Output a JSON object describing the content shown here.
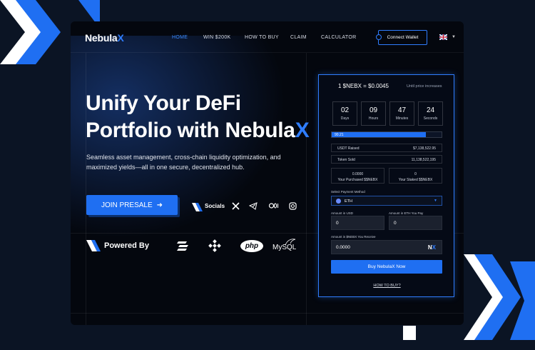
{
  "nav": {
    "logo_text": "Nebula",
    "logo_accent": "X",
    "items": [
      "HOME",
      "WIN $200K",
      "HOW TO BUY",
      "CLAIM",
      "CALCULATOR"
    ],
    "wallet_label": "Connect Wallet",
    "language_icon": "uk-flag-icon"
  },
  "hero": {
    "title_line1": "Unify Your DeFi",
    "title_line2_prefix": "Portfolio with Nebula",
    "title_line2_accent": "X",
    "subtitle": "Seamless asset management, cross-chain liquidity optimization, and maximized yields—all in one secure, decentralized hub.",
    "join_label": "JOIN PRESALE",
    "join_arrow": "➜",
    "socials_label": "Socials",
    "social_icons": [
      "x-icon",
      "telegram-icon",
      "medium-icon",
      "instagram-icon"
    ],
    "powered_label": "Powered By",
    "tech_icons": [
      "solana-icon",
      "binance-icon",
      "php-logo",
      "mysql-logo"
    ],
    "php_text": "php",
    "mysql_text": "MySQL"
  },
  "presale": {
    "price": "1 $NEBX = $0.0045",
    "price_note": "Until price increases",
    "countdown": [
      {
        "num": "02",
        "label": "Days"
      },
      {
        "num": "09",
        "label": "Hours"
      },
      {
        "num": "47",
        "label": "Minutes"
      },
      {
        "num": "24",
        "label": "Seconds"
      }
    ],
    "progress_label": "90.21",
    "progress_fraction": 0.86,
    "usdt_raised_label": "USDT Raised",
    "usdt_raised_value": "$7,138,522.95",
    "token_sold_label": "Token Sold",
    "token_sold_value": "11,138,522,195",
    "purchased_value": "0.0000",
    "purchased_label": "Your Purchased $$NEBX",
    "staked_value": "0",
    "staked_label": "Your Staked $$NEBX",
    "payment_label": "Select Payment Method",
    "payment_value": "ETH",
    "usd_label": "Amount in USD",
    "usd_value": "0",
    "eth_label": "Amount in ETH You Pay",
    "eth_value": "0",
    "nebx_label": "Amount in $NEBX You Receive",
    "nebx_value": "0.0000",
    "nx_badge_n": "N",
    "nx_badge_x": "X",
    "buy_label": "Buy NebulaX Now",
    "howto_label": "HOW TO BUY?"
  },
  "colors": {
    "accent": "#2f7dff",
    "button": "#1f6ff2",
    "background": "#04070e",
    "outer": "#0b1424"
  }
}
